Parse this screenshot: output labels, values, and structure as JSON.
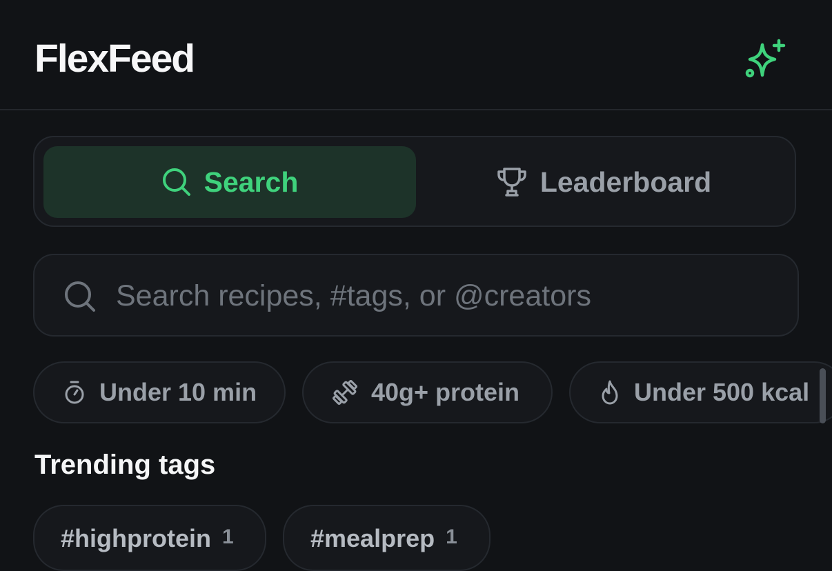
{
  "app": {
    "title": "FlexFeed"
  },
  "header": {
    "action_icon": "sparkle-icon",
    "accent": "#3fd27c"
  },
  "tabs": [
    {
      "label": "Search",
      "icon": "search-icon",
      "active": true
    },
    {
      "label": "Leaderboard",
      "icon": "trophy-icon",
      "active": false
    }
  ],
  "search": {
    "value": "",
    "placeholder": "Search recipes, #tags, or @creators"
  },
  "filters": [
    {
      "label": "Under 10 min",
      "icon": "stopwatch-icon"
    },
    {
      "label": "40g+ protein",
      "icon": "dumbbell-icon"
    },
    {
      "label": "Under 500 kcal",
      "icon": "flame-icon"
    }
  ],
  "trending": {
    "title": "Trending tags",
    "tags": [
      {
        "label": "#highprotein",
        "count": "1"
      },
      {
        "label": "#mealprep",
        "count": "1"
      }
    ]
  },
  "colors": {
    "background": "#111316",
    "surface": "#16181c",
    "border": "#25292f",
    "active_tab_bg": "#1d3329",
    "muted_text": "#9aa0a8"
  }
}
